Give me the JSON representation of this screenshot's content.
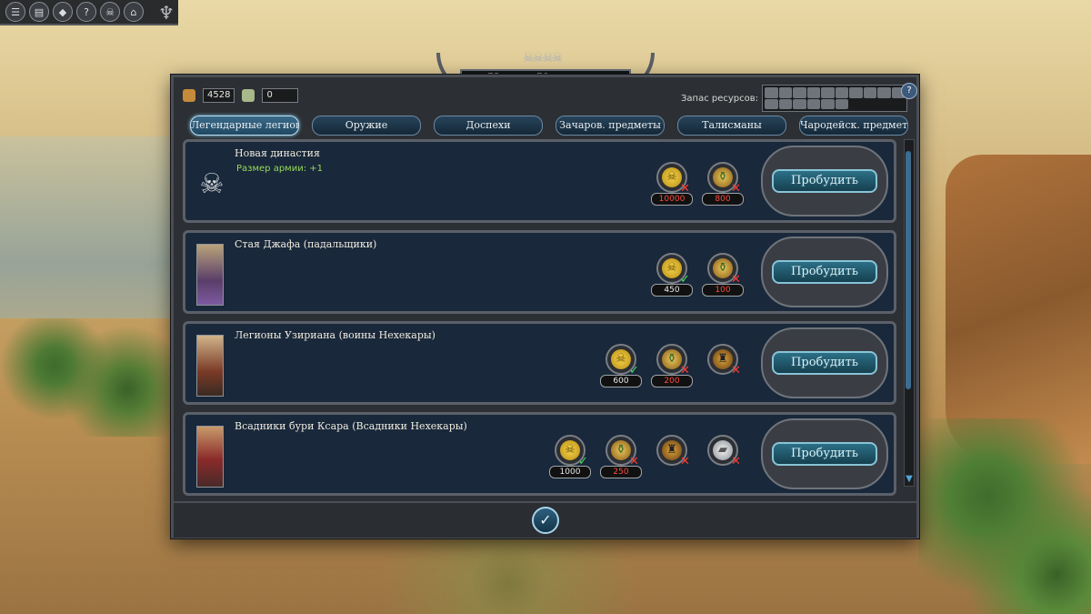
{
  "toolbar": {
    "buttons": [
      {
        "icon": "menu-icon",
        "glyph": "☰"
      },
      {
        "icon": "army-book-icon",
        "glyph": "▤"
      },
      {
        "icon": "lore-icon",
        "glyph": "◆"
      },
      {
        "icon": "help-icon",
        "glyph": "?"
      },
      {
        "icon": "skull-icon",
        "glyph": "☠"
      },
      {
        "icon": "camera-icon",
        "glyph": "⌂"
      }
    ]
  },
  "panel": {
    "title": "Культ Усопших",
    "resources": {
      "treasure": "4528",
      "canopic": "0"
    },
    "stock_label": "Запас ресурсов:",
    "help": "?",
    "tabs": [
      {
        "label": "Легендарные легионы",
        "active": true
      },
      {
        "label": "Оружие",
        "active": false
      },
      {
        "label": "Доспехи",
        "active": false
      },
      {
        "label": "Зачаров. предметы",
        "active": false
      },
      {
        "label": "Талисманы",
        "active": false
      },
      {
        "label": "Чародейск. предметы",
        "active": false
      }
    ],
    "rows": [
      {
        "name": "Новая династия",
        "effect": "Размер армии: +1",
        "button": "Пробудить",
        "costs": [
          {
            "type": "gold",
            "amount": "10000",
            "ok": false
          },
          {
            "type": "jar",
            "amount": "800",
            "ok": false
          }
        ]
      },
      {
        "name": "Стая Джафа (падальщики)",
        "effect": "",
        "button": "Пробудить",
        "costs": [
          {
            "type": "gold",
            "amount": "450",
            "ok": true
          },
          {
            "type": "jar",
            "amount": "100",
            "ok": false
          }
        ]
      },
      {
        "name": "Легионы Узириана (воины Нехекары)",
        "effect": "",
        "button": "Пробудить",
        "costs": [
          {
            "type": "gold",
            "amount": "600",
            "ok": true
          },
          {
            "type": "jar",
            "amount": "200",
            "ok": false
          },
          {
            "type": "canopic",
            "amount": "",
            "ok": false
          }
        ]
      },
      {
        "name": "Всадники бури Ксара (Всадники Нехекары)",
        "effect": "",
        "button": "Пробудить",
        "costs": [
          {
            "type": "gold",
            "amount": "1000",
            "ok": true
          },
          {
            "type": "jar",
            "amount": "250",
            "ok": false
          },
          {
            "type": "canopic",
            "amount": "",
            "ok": false
          },
          {
            "type": "ingot",
            "amount": "",
            "ok": false
          }
        ]
      }
    ],
    "confirm": "✓"
  }
}
